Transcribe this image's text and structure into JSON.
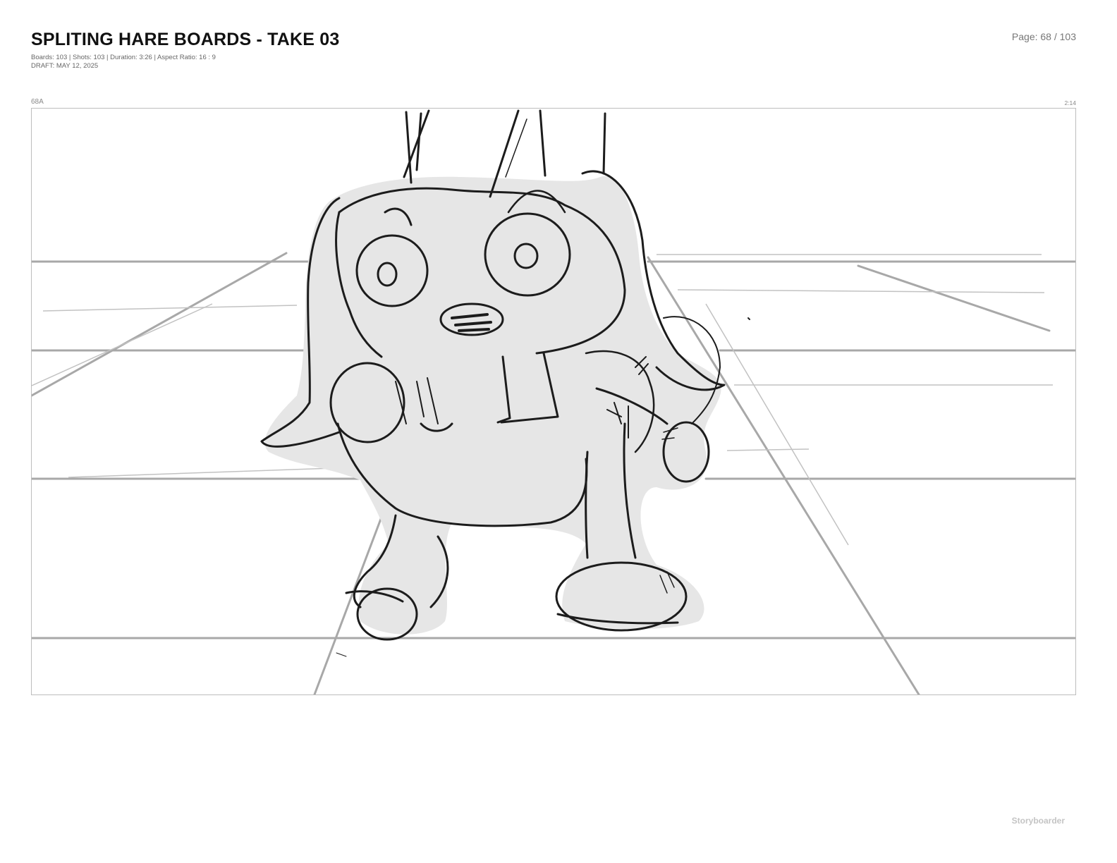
{
  "header": {
    "title": "SPLITING HARE BOARDS - TAKE 03",
    "stats": "Boards: 103  |  Shots: 103  |  Duration: 3:26  |  Aspect Ratio: 16 : 9",
    "draft": "DRAFT: MAY 12, 2025",
    "page": "Page: 68 / 103"
  },
  "board": {
    "id": "68A",
    "time": "2:14",
    "sketch_icon": "rabbit-sketch-illustration"
  },
  "footer": {
    "brand": "Storyboarder"
  },
  "colors": {
    "ink": "#1c1c1c",
    "fill": "#e6e6e6",
    "guide": "#a8a8a8",
    "border": "#bdbdbd",
    "brand": "#c4c4c4"
  }
}
